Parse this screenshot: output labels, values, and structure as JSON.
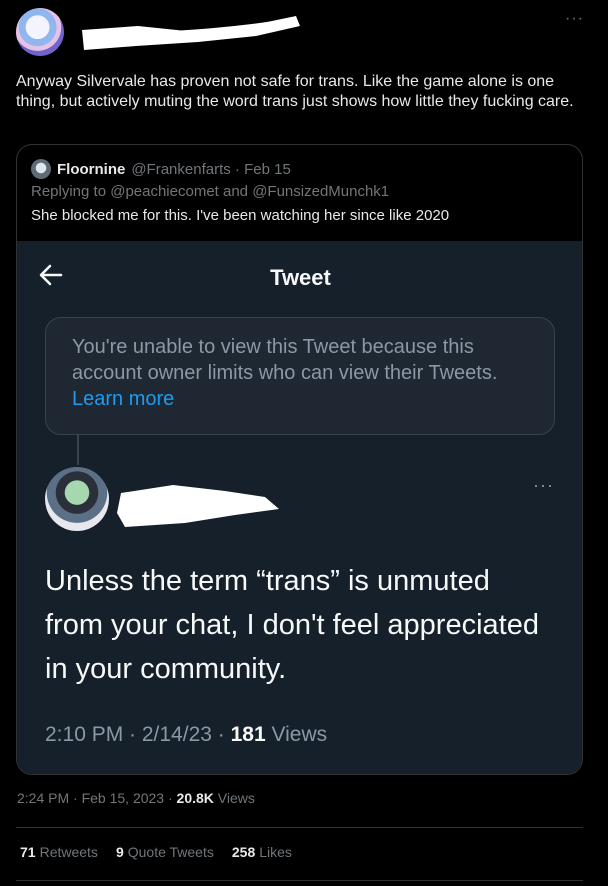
{
  "tweet": {
    "text": "Anyway Silvervale has proven not safe for trans. Like the game alone is one thing, but actively muting the word trans just shows how little they fucking care.",
    "more_icon": "···",
    "timestamp": "2:24 PM · Feb 15, 2023 · ",
    "views_count": "20.8K",
    "views_label": " Views"
  },
  "quote": {
    "name": "Floornine",
    "handle_date": "@Frankenfarts · Feb 15",
    "replying_to": "Replying to @peachiecomet and @FunsizedMunchk1",
    "text": "She blocked me for this. I've been watching her since like 2020",
    "screenshot": {
      "back_icon": "arrow-left",
      "title": "Tweet",
      "notice_text": "You're unable to view this Tweet because this account owner limits who can view their Tweets. ",
      "notice_link": "Learn more",
      "more_icon": "···",
      "body": "Unless the term “trans” is unmuted from your chat, I don't feel appreciated in your community.",
      "meta_time": "2:10 PM · 2/14/23 · ",
      "meta_views_count": "181",
      "meta_views_label": " Views"
    }
  },
  "stats": {
    "retweets_count": "71",
    "retweets_label": "Retweets",
    "quotes_count": "9",
    "quotes_label": "Quote Tweets",
    "likes_count": "258",
    "likes_label": "Likes"
  },
  "colors": {
    "background": "#000000",
    "accent": "#1d9bf0",
    "secondary_text": "#71767b",
    "screenshot_bg": "#15202b"
  }
}
